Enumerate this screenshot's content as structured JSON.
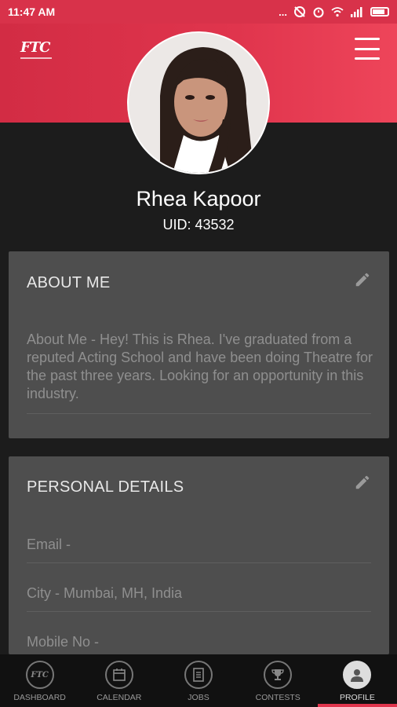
{
  "status_bar": {
    "time": "11:47 AM",
    "extra_icons": "..."
  },
  "header": {
    "logo_text": "FTC",
    "menu_icon": "hamburger-menu-icon"
  },
  "profile": {
    "name": "Rhea Kapoor",
    "uid": "UID: 43532"
  },
  "about": {
    "title": "ABOUT ME",
    "text": "About Me - Hey! This is Rhea. I've graduated from a reputed Acting School and have been doing Theatre for the past three years. Looking for an opportunity in this industry.",
    "edit_icon": "pencil-icon"
  },
  "personal": {
    "title": "PERSONAL DETAILS",
    "edit_icon": "pencil-icon",
    "email": "Email -",
    "city": "City - Mumbai, MH, India",
    "mobile": "Mobile No -"
  },
  "nav": {
    "items": [
      {
        "label": "DASHBOARD",
        "icon": "ftc-logo-icon"
      },
      {
        "label": "CALENDAR",
        "icon": "calendar-icon"
      },
      {
        "label": "JOBS",
        "icon": "document-icon"
      },
      {
        "label": "CONTESTS",
        "icon": "trophy-icon"
      },
      {
        "label": "PROFILE",
        "icon": "person-icon"
      }
    ],
    "active": "PROFILE",
    "accent": "#e0354d"
  },
  "colors": {
    "brand": "#d8324a",
    "background": "#1c1c1c",
    "card": "#4e4e4e"
  }
}
